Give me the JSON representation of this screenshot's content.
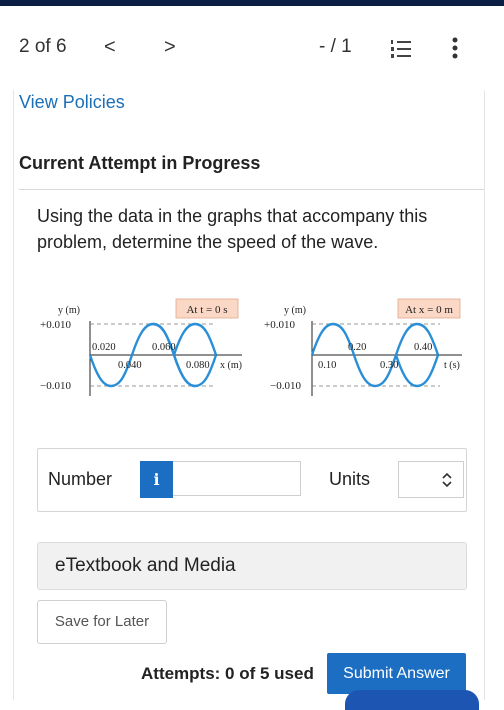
{
  "nav": {
    "page_count": "2 of 6",
    "prev": "<",
    "next": ">",
    "score": "- / 1",
    "list_icon": "numbered-list-icon",
    "more_icon": "vertical-dots-icon"
  },
  "links": {
    "policies": "View Policies"
  },
  "attempt": {
    "title": "Current Attempt in Progress"
  },
  "question": {
    "text": "Using the data in the graphs that accompany this problem, determine the speed of the wave."
  },
  "graph_left": {
    "badge": "At t = 0 s",
    "ylabel": "y (m)",
    "y_top": "+0.010",
    "y_bottom": "−0.010",
    "ticks": [
      "0.020",
      "0.040",
      "0.060",
      "0.080"
    ],
    "xlabel": "x (m)"
  },
  "graph_right": {
    "badge": "At x = 0 m",
    "ylabel": "y (m)",
    "y_top": "+0.010",
    "y_bottom": "−0.010",
    "ticks": [
      "0.10",
      "0.20",
      "0.30",
      "0.40"
    ],
    "xlabel": "t (s)"
  },
  "answer": {
    "number_label": "Number",
    "info_glyph": "i",
    "number_value": "",
    "units_label": "Units",
    "units_value": ""
  },
  "resources": {
    "etextbook": "eTextbook and Media"
  },
  "actions": {
    "save_later": "Save for Later",
    "attempts": "Attempts: 0 of 5 used",
    "submit": "Submit Answer"
  },
  "colors": {
    "accent": "#1b6ec2",
    "link": "#1a6fb7",
    "wave": "#2a8fd6",
    "badge_bg": "#fbd7c5",
    "topbar": "#0b1f45"
  }
}
